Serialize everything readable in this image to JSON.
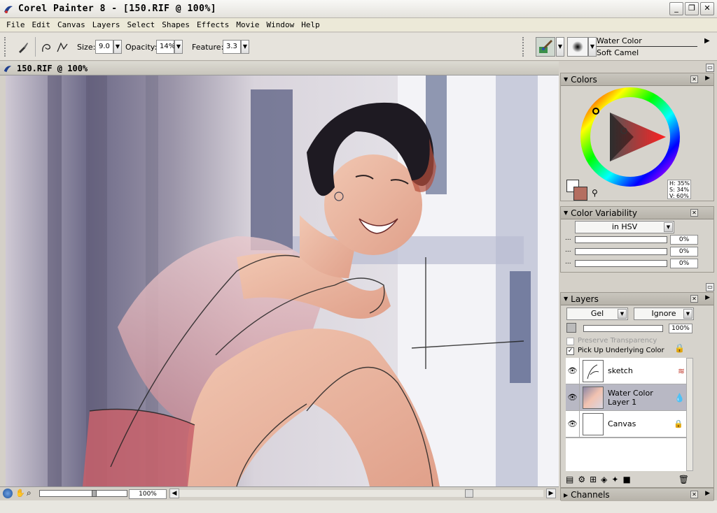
{
  "window": {
    "title": "Corel Painter 8 - [150.RIF @ 100%]"
  },
  "menu": [
    "File",
    "Edit",
    "Canvas",
    "Layers",
    "Select",
    "Shapes",
    "Effects",
    "Movie",
    "Window",
    "Help"
  ],
  "property_bar": {
    "size_label": "Size:",
    "size_value": "9.0",
    "opacity_label": "Opacity:",
    "opacity_value": "14%",
    "feature_label": "Feature:",
    "feature_value": "3.3",
    "brush_category": "Water Color",
    "brush_variant": "Soft Camel"
  },
  "document": {
    "title": "150.RIF @ 100%",
    "zoom": "100%"
  },
  "colors_panel": {
    "title": "Colors",
    "hsv": {
      "h": "H: 35%",
      "s": "S: 34%",
      "v": "V: 60%"
    },
    "main_color": "#b46e60",
    "additional_color": "#ffffff"
  },
  "color_variability": {
    "title": "Color Variability",
    "mode": "in HSV",
    "values": [
      "0%",
      "0%",
      "0%"
    ]
  },
  "layers_panel": {
    "title": "Layers",
    "composite_method": "Gel",
    "composite_depth": "Ignore",
    "opacity": "100%",
    "preserve_transparency": "Preserve Transparency",
    "pick_up_color": "Pick Up Underlying Color",
    "layers": [
      {
        "name": "sketch"
      },
      {
        "name": "Water Color Layer 1"
      },
      {
        "name": "Canvas"
      }
    ]
  },
  "channels_panel": {
    "title": "Channels"
  }
}
